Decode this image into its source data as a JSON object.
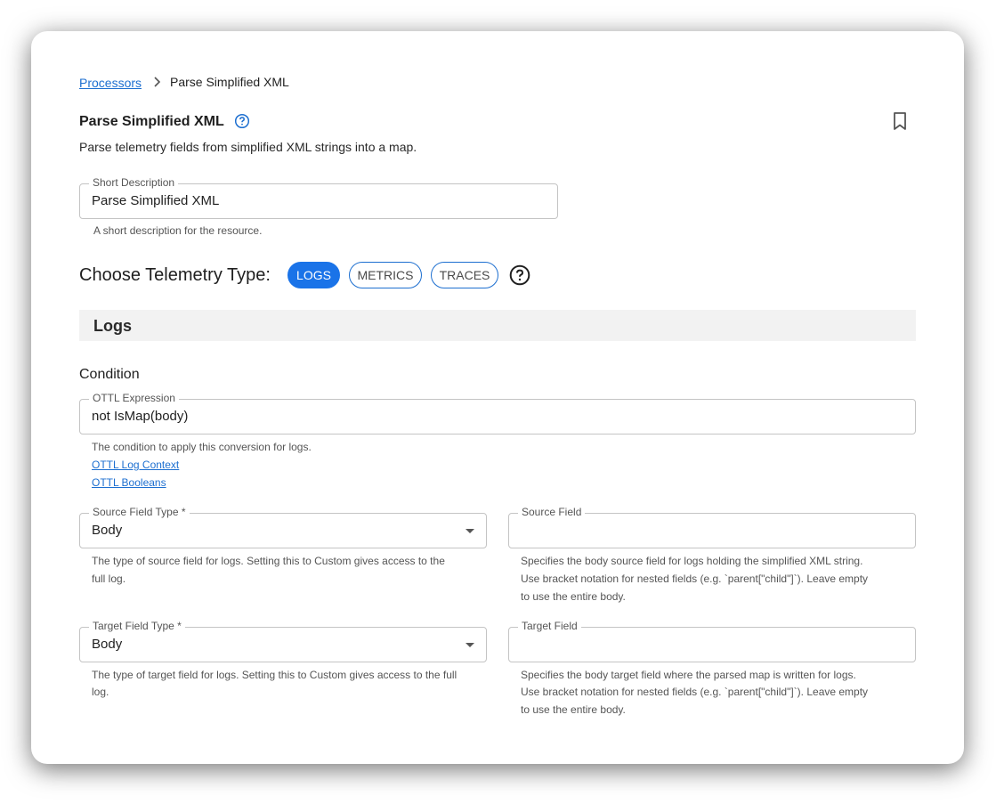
{
  "breadcrumb": {
    "parent": "Processors",
    "current": "Parse Simplified XML"
  },
  "header": {
    "title": "Parse Simplified XML",
    "description": "Parse telemetry fields from simplified XML strings into a map."
  },
  "short_description": {
    "label": "Short Description",
    "value": "Parse Simplified XML",
    "helper": "A short description for the resource."
  },
  "telemetry": {
    "label": "Choose Telemetry Type:",
    "types": [
      {
        "label": "LOGS",
        "active": true
      },
      {
        "label": "METRICS",
        "active": false
      },
      {
        "label": "TRACES",
        "active": false
      }
    ]
  },
  "logs_section": {
    "title": "Logs",
    "condition_label": "Condition",
    "ottl": {
      "label": "OTTL Expression",
      "value": "not IsMap(body)",
      "helper": "The condition to apply this conversion for logs.",
      "links": [
        "OTTL Log Context",
        "OTTL Booleans"
      ]
    },
    "source_field_type": {
      "label": "Source Field Type *",
      "value": "Body",
      "helper_lines": [
        "The type of source field for logs. Setting this to Custom gives access to the",
        "full log."
      ]
    },
    "source_field": {
      "label": "Source Field",
      "value": "",
      "helper_lines": [
        "Specifies the body source field for logs holding the simplified XML string.",
        "Use bracket notation for nested fields (e.g. `parent[\"child\"]`). Leave empty",
        "to use the entire body."
      ]
    },
    "target_field_type": {
      "label": "Target Field Type *",
      "value": "Body",
      "helper_lines": [
        "The type of target field for logs. Setting this to Custom gives access to the full",
        "log."
      ]
    },
    "target_field": {
      "label": "Target Field",
      "value": "",
      "helper_lines": [
        "Specifies the body target field where the parsed map is written for logs.",
        "Use bracket notation for nested fields (e.g. `parent[\"child\"]`). Leave empty",
        "to use the entire body."
      ]
    }
  },
  "colors": {
    "accent": "#1a73e8",
    "link": "#1d6fd0",
    "section_bg": "#f2f2f2"
  }
}
